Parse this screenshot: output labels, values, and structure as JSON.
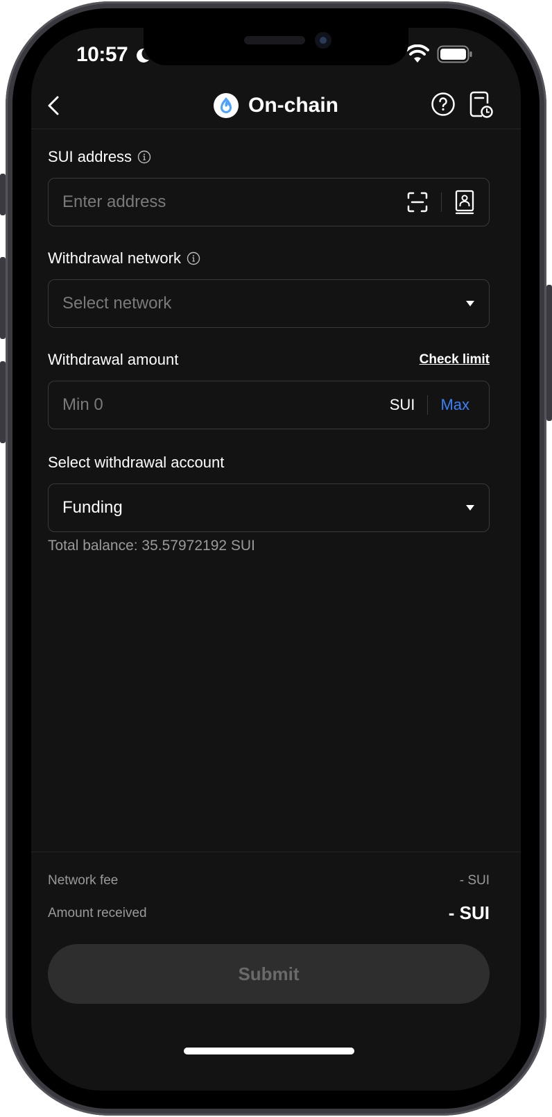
{
  "status_bar": {
    "time": "10:57",
    "icons": [
      "moon-icon",
      "signal-icon",
      "wifi-icon",
      "battery-icon"
    ]
  },
  "nav": {
    "title": "On-chain",
    "token_logo": "sui-logo-icon",
    "back_icon": "chevron-left-icon",
    "help_icon": "help-circle-icon",
    "history_icon": "history-icon"
  },
  "form": {
    "address": {
      "label": "SUI address",
      "placeholder": "Enter address",
      "value": ""
    },
    "network": {
      "label": "Withdrawal network",
      "placeholder": "Select network"
    },
    "amount": {
      "label": "Withdrawal amount",
      "check_limit_label": "Check limit",
      "placeholder": "Min 0",
      "value": "",
      "unit": "SUI",
      "max_label": "Max"
    },
    "account": {
      "label": "Select withdrawal account",
      "selected": "Funding",
      "balance_text": "Total balance: 35.57972192 SUI"
    }
  },
  "summary": {
    "network_fee_label": "Network fee",
    "network_fee_value": "- SUI",
    "amount_received_label": "Amount received",
    "amount_received_value": "- SUI"
  },
  "actions": {
    "submit_label": "Submit"
  },
  "colors": {
    "background": "#131313",
    "accent": "#3b82f6",
    "sui_brand": "#4da2ff",
    "submit_disabled_bg": "#2e2e2e"
  }
}
